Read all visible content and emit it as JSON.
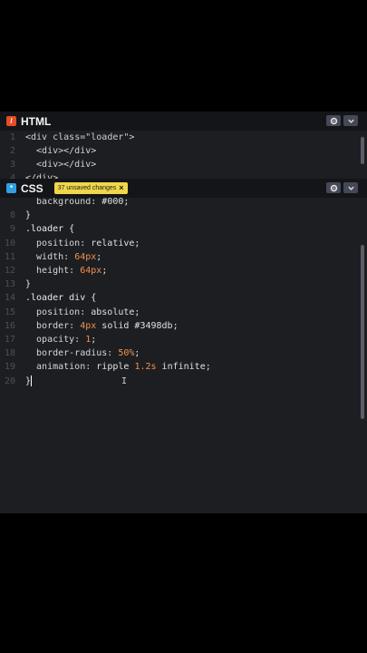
{
  "html_panel": {
    "label": "HTML",
    "lines": [
      {
        "n": "1",
        "segs": [
          [
            "c-tag",
            "<div "
          ],
          [
            "c-attr",
            "class="
          ],
          [
            "c-str",
            "\"loader\""
          ],
          [
            "c-tag",
            ">"
          ]
        ]
      },
      {
        "n": "2",
        "segs": [
          [
            "c-tag",
            "  <div></div>"
          ]
        ]
      },
      {
        "n": "3",
        "segs": [
          [
            "c-tag",
            "  <div></div>"
          ]
        ]
      },
      {
        "n": "4",
        "segs": [
          [
            "c-tag",
            "</div>"
          ]
        ]
      }
    ]
  },
  "css_panel": {
    "label": "CSS",
    "unsaved_badge": "37 unsaved changes",
    "lines": [
      {
        "n": "",
        "segs": [
          [
            "c-prop",
            "  background: "
          ],
          [
            "c-val",
            "#000;"
          ]
        ]
      },
      {
        "n": "8",
        "segs": [
          [
            "c-sel",
            "}"
          ]
        ]
      },
      {
        "n": "9",
        "segs": [
          [
            "c-sel",
            ".loader {"
          ]
        ]
      },
      {
        "n": "10",
        "segs": [
          [
            "c-prop",
            "  position: "
          ],
          [
            "c-val",
            "relative;"
          ]
        ]
      },
      {
        "n": "11",
        "segs": [
          [
            "c-prop",
            "  width: "
          ],
          [
            "c-num",
            "64px"
          ],
          [
            "c-val",
            ";"
          ]
        ]
      },
      {
        "n": "12",
        "segs": [
          [
            "c-prop",
            "  height: "
          ],
          [
            "c-num",
            "64px"
          ],
          [
            "c-val",
            ";"
          ]
        ]
      },
      {
        "n": "13",
        "segs": [
          [
            "c-sel",
            "}"
          ]
        ]
      },
      {
        "n": "14",
        "segs": [
          [
            "c-sel",
            ".loader div {"
          ]
        ]
      },
      {
        "n": "15",
        "segs": [
          [
            "c-prop",
            "  position: "
          ],
          [
            "c-val",
            "absolute;"
          ]
        ]
      },
      {
        "n": "16",
        "segs": [
          [
            "c-prop",
            "  border: "
          ],
          [
            "c-num",
            "4px"
          ],
          [
            "c-val",
            " solid #3498db;"
          ]
        ]
      },
      {
        "n": "17",
        "segs": [
          [
            "c-prop",
            "  opacity: "
          ],
          [
            "c-num",
            "1"
          ],
          [
            "c-val",
            ";"
          ]
        ]
      },
      {
        "n": "18",
        "segs": [
          [
            "c-prop",
            "  border-radius: "
          ],
          [
            "c-num",
            "50%"
          ],
          [
            "c-val",
            ";"
          ]
        ]
      },
      {
        "n": "19",
        "segs": [
          [
            "c-prop",
            "  animation: "
          ],
          [
            "c-val",
            "ripple "
          ],
          [
            "c-num",
            "1.2s"
          ],
          [
            "c-val",
            " infinite;"
          ]
        ]
      },
      {
        "n": "20",
        "segs": [
          [
            "c-sel",
            "}"
          ]
        ],
        "caret": true
      }
    ]
  },
  "icons": {
    "settings": "gear-icon",
    "collapse": "chevron-down-icon",
    "cursor": "text-cursor-icon"
  },
  "colors": {
    "editor_bg": "#1d1e22",
    "header_bg": "#141518",
    "badge": "#f0d649",
    "html_icon": "#e44d26",
    "css_icon": "#2da1e4",
    "number": "#f0924b"
  }
}
